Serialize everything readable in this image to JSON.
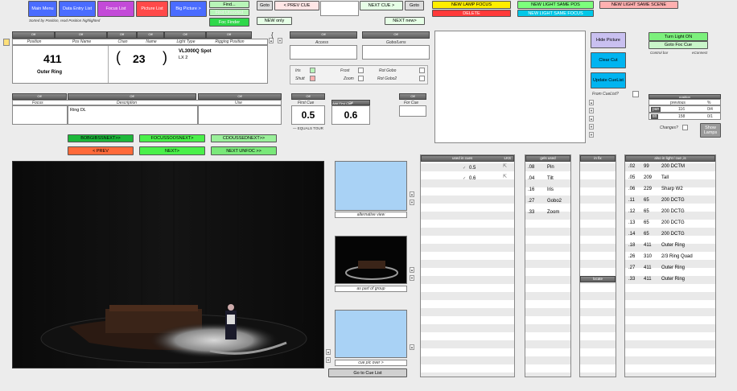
{
  "nav": {
    "main_menu": "Main Menu",
    "data_entry_list": "Data Entry List",
    "focus_list": "Focus List",
    "picture_list": "Picture List",
    "big_picture": "Big Picture >",
    "sort_note": "Sorted by Position, read Position highlighted",
    "find": "Find...",
    "find2": "Find Unsorted",
    "foc_finder": "Foc Finder"
  },
  "cue_bar": {
    "goto1": "Goto",
    "prev_cue": "< PREV CUE",
    "next_cue": "NEXT CUE >",
    "goto2": "Goto",
    "new_only": "NEW only",
    "next_new": "NEXT new>",
    "new_lamp_focus": "NEW LAMP FOCUS",
    "delete": "DELETE",
    "new_light_same_pos": "NEW LIGHT SAME POS",
    "new_light_same_focus": "NEW LIGHT SAME FOCUS",
    "new_light_same_scene": "NEW LIGHT SAME SCENE"
  },
  "fixture": {
    "headers": [
      "Position",
      "Pos Name",
      "Chan",
      "Name",
      "Light Type",
      "Rigging Position"
    ],
    "position": "411",
    "position_name": "Outer Ring",
    "chan": "23",
    "light_type": "VL3000Q Spot",
    "light_sub": "LX 2"
  },
  "accessory": {
    "headers": [
      "Access",
      "Gobo/Lens"
    ],
    "checks": [
      "Iris",
      "Shutt",
      "Frost",
      "Zoom",
      "Rot Gobo",
      "Rot Gobo2"
    ]
  },
  "focus_row": {
    "headers": [
      "Focus",
      "Description",
      "Use"
    ],
    "description": "Ring DL",
    "first_cue_hdr": "First Cue",
    "first_cue_val": "0.5",
    "add_first_hdr": "Add First Cue",
    "add_first_val": "0.6",
    "equals_tour": "— EQUALS TOUR",
    "for_cue_hdr": "For Cue"
  },
  "right_panel": {
    "hide_picture": "Hide Picture",
    "clear_cut": "Clear Cut",
    "update_cuelist": "Update CueList",
    "from_cuelist": "From CueList?",
    "turn_light_on": "Turn Light ON",
    "goto_foc_cue": "Goto Foc Cue",
    "control_bar": "Control bar",
    "econnect": "eConnect",
    "position_hdr": "position",
    "previous": "previous",
    "pct": "%",
    "pan_lbl": "pan",
    "tilt_lbl": "tilt",
    "pan_prev": "116",
    "pan_pct": "0/4",
    "tilt_prev": "158",
    "tilt_pct": "0/1",
    "changes": "Changes?",
    "show_lamps": "Show Lamps"
  },
  "step_buttons": {
    "b1": "BOBGIBSSNEXT>>",
    "b2": "FOCUSSOOSNEXT>",
    "b3": "CDOUSSEDNEXT>>",
    "prev": "< PREV",
    "next": "NEXT>",
    "next_unfoc": "NEXT UNFOC >>"
  },
  "thumbs": {
    "t1_caption": "alternative view",
    "t2_caption": "as part of group",
    "t3_caption": "cue pic over >",
    "goto_cue_list": "Go to Cue List"
  },
  "cues_panel": {
    "header": "used in cues",
    "header2": "LKS",
    "rows": [
      "0.5",
      "0.6"
    ]
  },
  "gobo_panel": {
    "header": "gels used",
    "rows": [
      {
        "num": ".08",
        "name": "Pin"
      },
      {
        "num": ".04",
        "name": "Tilt"
      },
      {
        "num": ".16",
        "name": "Iris"
      },
      {
        "num": ".27",
        "name": "Gobo2"
      },
      {
        "num": ".33",
        "name": "Zoom"
      }
    ]
  },
  "mid_panel": {
    "header": "in fix",
    "mid_label": "locate"
  },
  "chan_panel": {
    "header": "also in light / cue ,is",
    "rows": [
      {
        "cue": ".02",
        "ch": "99",
        "desc": "200 DCTM"
      },
      {
        "cue": ".05",
        "ch": "209",
        "desc": "Tall"
      },
      {
        "cue": ".06",
        "ch": "229",
        "desc": "Sharp W2"
      },
      {
        "cue": ".11",
        "ch": "65",
        "desc": "200 DCTG"
      },
      {
        "cue": ".12",
        "ch": "65",
        "desc": "200 DCTG"
      },
      {
        "cue": ".13",
        "ch": "65",
        "desc": "200 DCTG"
      },
      {
        "cue": ".14",
        "ch": "65",
        "desc": "200 DCTG"
      },
      {
        "cue": ".18",
        "ch": "411",
        "desc": "Outer Ring"
      },
      {
        "cue": ".26",
        "ch": "310",
        "desc": "2/3 Ring Quad"
      },
      {
        "cue": ".27",
        "ch": "411",
        "desc": "Outer Ring"
      },
      {
        "cue": ".33",
        "ch": "411",
        "desc": "Outer Ring"
      }
    ]
  },
  "colors": {
    "blue_btn": "#4a6cff",
    "purple_btn": "#c34ad8",
    "red_btn": "#ff4a4a",
    "green_btn": "#2fd84a",
    "yellow_btn": "#ffee00",
    "cyan_btn": "#00c8e8",
    "light_blue_thumb": "#a9d2f5"
  }
}
